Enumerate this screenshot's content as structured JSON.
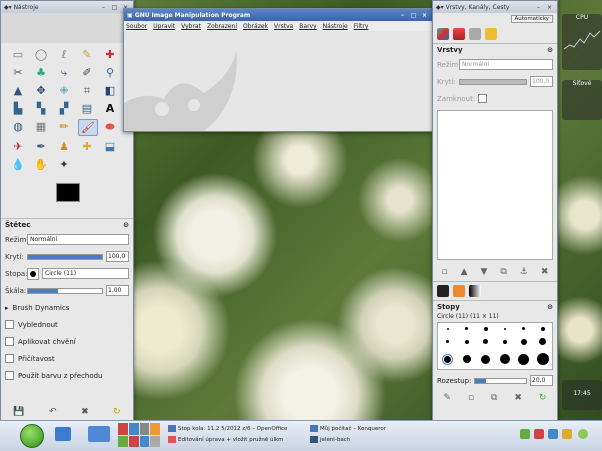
{
  "toolbox": {
    "title": "Nástroje",
    "tool_options": {
      "title": "Štětec",
      "mode_label": "Režim:",
      "mode_value": "Normální",
      "opacity_label": "Krytí:",
      "opacity_value": "100,0",
      "brush_label": "Stopa:",
      "brush_value": "Circle (11)",
      "scale_label": "Škála:",
      "scale_value": "1,00",
      "dynamics_label": "Brush Dynamics",
      "options": [
        "Vyblednout",
        "Aplikovat chvění",
        "Přičítavost",
        "Použít barvu z přechodu"
      ]
    },
    "fg_color": "#000000",
    "bg_color": "#ffffff"
  },
  "main_window": {
    "title": "GNU Image Manipulation Program",
    "menu": [
      "Soubor",
      "Upravit",
      "Vybrat",
      "Zobrazení",
      "Obrázek",
      "Vrstva",
      "Barvy",
      "Nástroje",
      "Filtry"
    ]
  },
  "dock": {
    "title": "Vrstvy, Kanály, Cesty",
    "auto_button": "Automaticky",
    "layers": {
      "title": "Vrstvy",
      "mode_label": "Režim:",
      "mode_value": "Normální",
      "opacity_label": "Krytí:",
      "opacity_value": "100,0",
      "lock_label": "Zamknout:"
    },
    "brushes": {
      "title": "Stopy",
      "subtitle": "Circle (11) (11 × 11)",
      "spacing_label": "Rozestup:",
      "spacing_value": "20,0"
    }
  },
  "widgets": {
    "cpu_label": "CPU",
    "network_label": "Síťové"
  },
  "taskbar": {
    "tasks": [
      "Stop kola: 11.2 5/2012 z/6 – OpenOffice",
      "Editování úprava + vložit pružně úlkm",
      "Můj počítač – Konqueror",
      "jeleni-bach"
    ],
    "clock": "17:45"
  },
  "colors": {
    "active_title": "#3a64a8",
    "accent": "#4a7cc2"
  }
}
